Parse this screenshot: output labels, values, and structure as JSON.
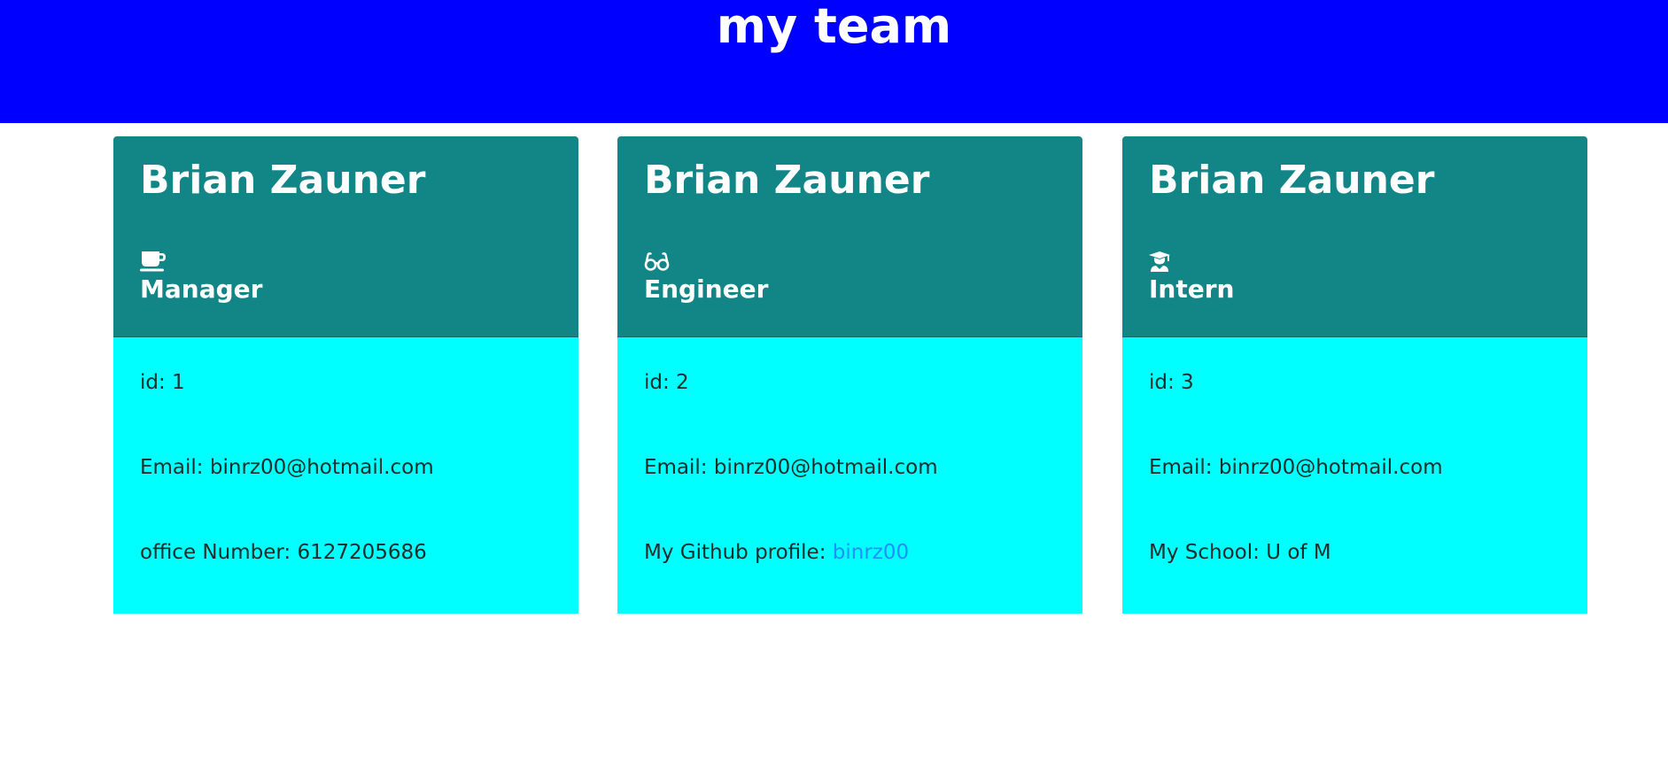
{
  "header": {
    "title": "my team"
  },
  "cards": [
    {
      "name": "Brian Zauner",
      "role": "Manager",
      "icon": "coffee-icon",
      "id_text": "id: 1",
      "email_text": "Email: binrz00@hotmail.com",
      "extra_text": "office Number: 6127205686"
    },
    {
      "name": "Brian Zauner",
      "role": "Engineer",
      "icon": "glasses-icon",
      "id_text": "id: 2",
      "email_text": "Email: binrz00@hotmail.com",
      "extra_label": "My Github profile: ",
      "extra_link": "binrz00"
    },
    {
      "name": "Brian Zauner",
      "role": "Intern",
      "icon": "graduate-icon",
      "id_text": "id: 3",
      "email_text": "Email: binrz00@hotmail.com",
      "extra_text": "My School: U of M"
    }
  ],
  "colors": {
    "header_bg": "#0000ff",
    "card_head_bg": "#128686",
    "card_body_bg": "#00ffff",
    "link": "#1e90ff"
  }
}
